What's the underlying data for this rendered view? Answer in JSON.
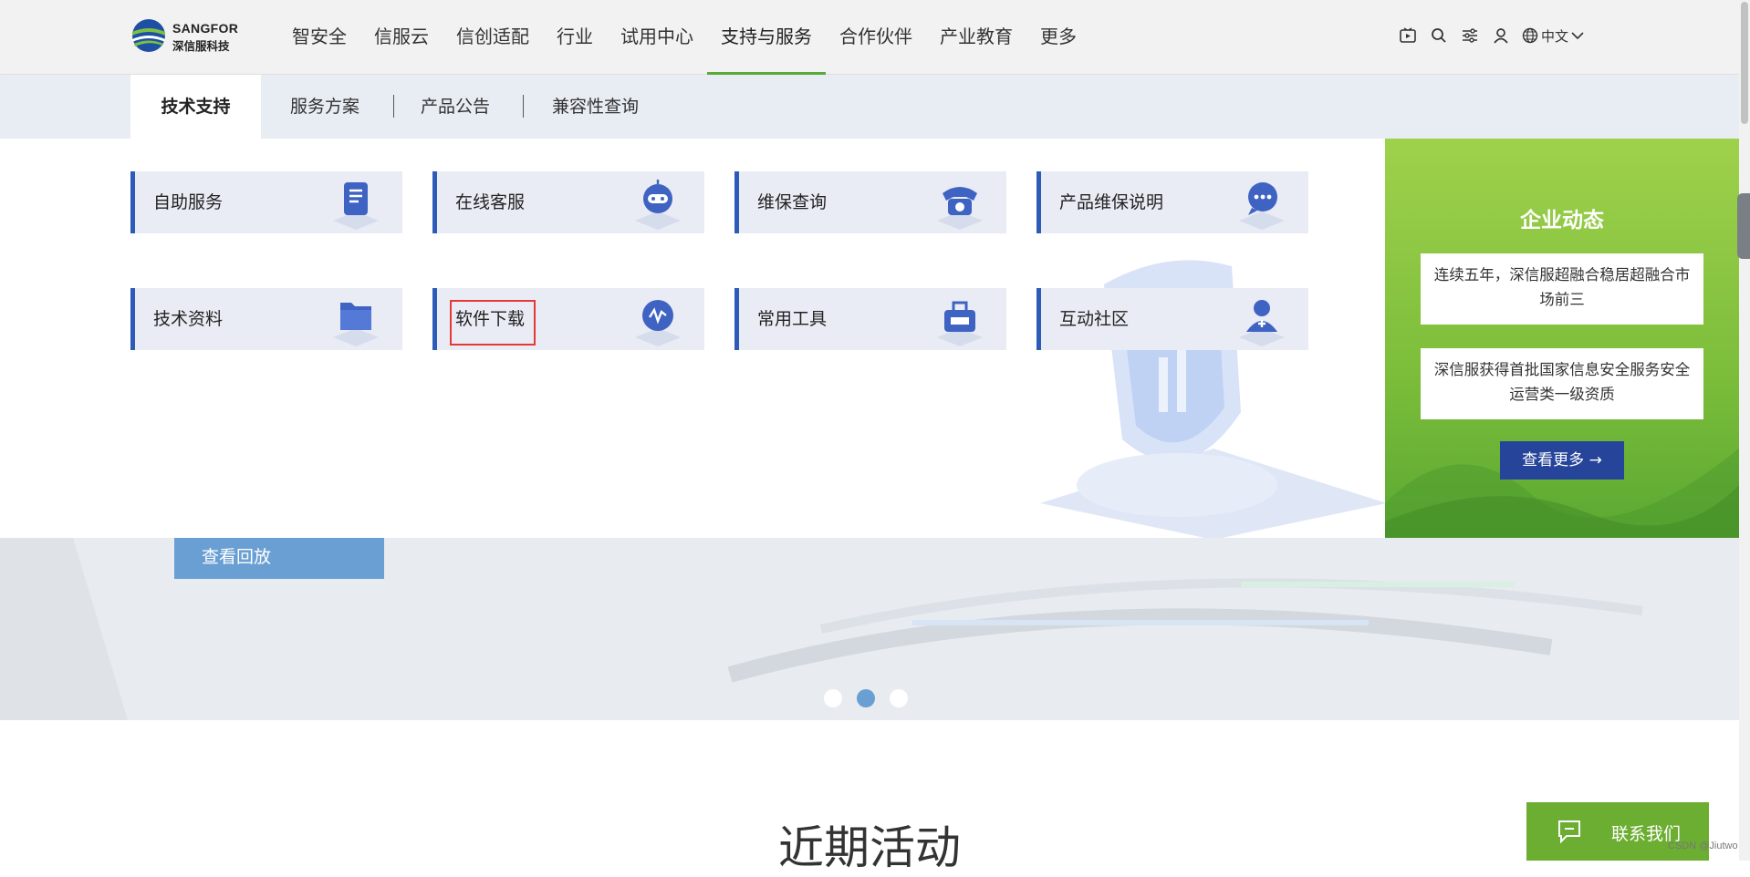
{
  "header": {
    "logo_en": "SANGFOR",
    "logo_cn": "深信服科技",
    "nav": [
      "智安全",
      "信服云",
      "信创适配",
      "行业",
      "试用中心",
      "支持与服务",
      "合作伙伴",
      "产业教育",
      "更多"
    ],
    "active_nav_index": 5,
    "tools": {
      "video_icon": "play-screen-icon",
      "search_icon": "search-icon",
      "filter_icon": "sliders-icon",
      "user_icon": "user-icon",
      "globe_icon": "globe-icon",
      "language": "中文"
    }
  },
  "submenu": {
    "tabs": [
      "技术支持",
      "服务方案",
      "产品公告",
      "兼容性查询"
    ],
    "active_tab_index": 0
  },
  "cards": [
    {
      "label": "自助服务",
      "icon": "document-icon"
    },
    {
      "label": "在线客服",
      "icon": "robot-icon"
    },
    {
      "label": "维保查询",
      "icon": "telephone-icon"
    },
    {
      "label": "产品维保说明",
      "icon": "chat-bubble-icon"
    },
    {
      "label": "技术资料",
      "icon": "folder-icon"
    },
    {
      "label": "软件下载",
      "icon": "download-globe-icon"
    },
    {
      "label": "常用工具",
      "icon": "toolbox-icon"
    },
    {
      "label": "互动社区",
      "icon": "community-user-icon"
    }
  ],
  "highlighted_card": "软件下载",
  "news": {
    "title": "企业动态",
    "items": [
      "连续五年，深信服超融合稳居超融合市场前三",
      "深信服获得首批国家信息安全服务安全运营类一级资质"
    ],
    "more": "查看更多 →"
  },
  "hero": {
    "button": "查看回放",
    "carousel_dots": 3,
    "active_dot": 1
  },
  "section": {
    "title": "近期活动"
  },
  "contact": {
    "label": "联系我们",
    "icon": "chat-icon"
  },
  "watermark": "CSDN @Jiutwo",
  "colors": {
    "brand_green": "#5cab3a",
    "card_accent": "#2d5bb8",
    "news_button": "#26459a",
    "highlight": "#e53935"
  }
}
